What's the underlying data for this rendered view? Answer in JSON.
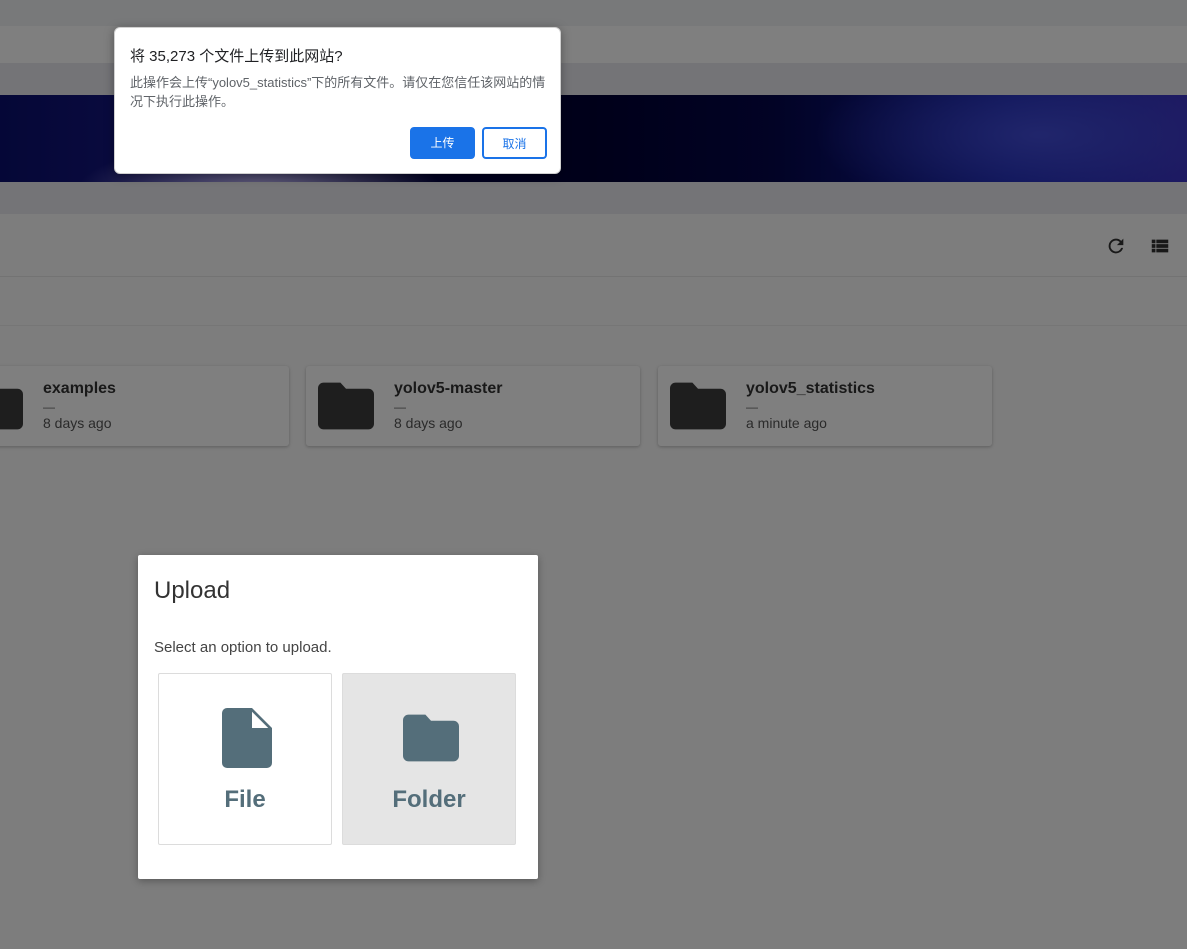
{
  "confirm_dialog": {
    "title": "将 35,273 个文件上传到此网站?",
    "message": "此操作会上传“yolov5_statistics”下的所有文件。请仅在您信任该网站的情况下执行此操作。",
    "upload_button": "上传",
    "cancel_button": "取消",
    "accent_color": "#1a73e8"
  },
  "toolbar": {
    "icons": [
      "refresh-icon",
      "list-view-icon"
    ]
  },
  "files": [
    {
      "name": "examples",
      "size": "—",
      "modified": "8 days ago",
      "icon": "folder-icon"
    },
    {
      "name": "yolov5-master",
      "size": "—",
      "modified": "8 days ago",
      "icon": "folder-icon"
    },
    {
      "name": "yolov5_statistics",
      "size": "—",
      "modified": "a minute ago",
      "icon": "folder-icon"
    }
  ],
  "upload_dialog": {
    "title": "Upload",
    "description": "Select an option to upload.",
    "options": [
      {
        "label": "File",
        "icon": "file-icon"
      },
      {
        "label": "Folder",
        "icon": "folder-icon"
      }
    ],
    "icon_color": "#546e7a"
  }
}
